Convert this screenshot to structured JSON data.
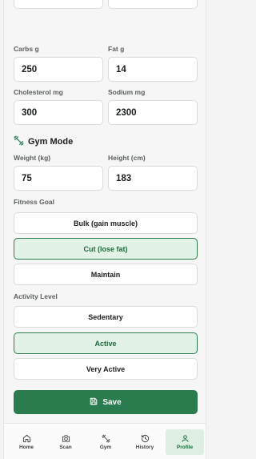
{
  "nutrients": {
    "carbs": {
      "label": "Carbs g",
      "value": "250"
    },
    "fat": {
      "label": "Fat g",
      "value": "14"
    },
    "cholesterol": {
      "label": "Cholesterol mg",
      "value": "300"
    },
    "sodium": {
      "label": "Sodium mg",
      "value": "2300"
    }
  },
  "gym": {
    "title": "Gym Mode",
    "weight": {
      "label": "Weight (kg)",
      "value": "75"
    },
    "height": {
      "label": "Height (cm)",
      "value": "183"
    },
    "fitness_goal_label": "Fitness Goal",
    "fitness_goals": [
      "Bulk (gain muscle)",
      "Cut (lose fat)",
      "Maintain"
    ],
    "selected_goal": "Cut (lose fat)",
    "activity_label": "Activity Level",
    "activity_levels": [
      "Sedentary",
      "Active",
      "Very Active"
    ],
    "selected_activity": "Active"
  },
  "save_label": "Save",
  "nav": {
    "home": "Home",
    "scan": "Scan",
    "gym": "Gym",
    "history": "History",
    "profile": "Profile"
  },
  "colors": {
    "accent": "#2a7b4d",
    "selected_bg": "#e3f2e7"
  }
}
